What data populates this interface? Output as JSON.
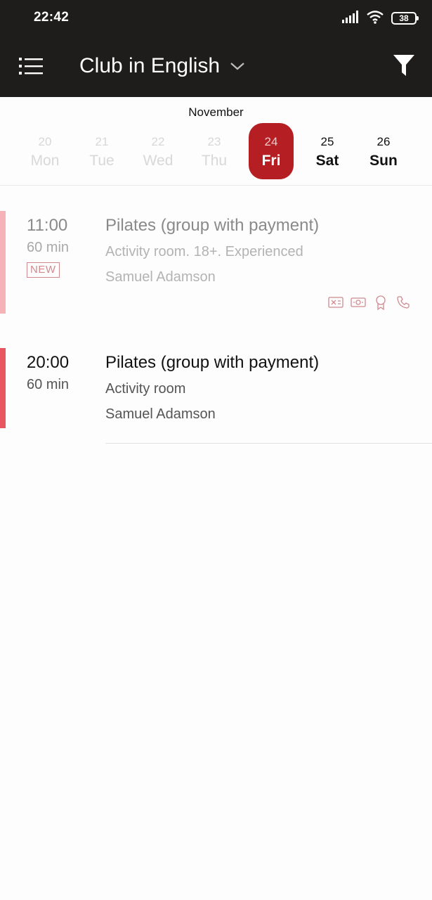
{
  "status_bar": {
    "time": "22:42",
    "battery": "38"
  },
  "app_bar": {
    "title": "Club in English",
    "menu_icon": "list-icon",
    "dropdown_icon": "chevron-down-icon",
    "filter_icon": "filter-icon"
  },
  "calendar": {
    "month": "November",
    "days": [
      {
        "num": "20",
        "weekday": "Mon",
        "state": "past"
      },
      {
        "num": "21",
        "weekday": "Tue",
        "state": "past"
      },
      {
        "num": "22",
        "weekday": "Wed",
        "state": "past"
      },
      {
        "num": "23",
        "weekday": "Thu",
        "state": "past"
      },
      {
        "num": "24",
        "weekday": "Fri",
        "state": "selected"
      },
      {
        "num": "25",
        "weekday": "Sat",
        "state": "future"
      },
      {
        "num": "26",
        "weekday": "Sun",
        "state": "future"
      }
    ]
  },
  "events": [
    {
      "time": "11:00",
      "duration": "60 min",
      "badge": "NEW",
      "title": "Pilates (group with payment)",
      "place": "Activity room. 18+. Experienced",
      "trainer": "Samuel Adamson",
      "state": "past",
      "icons": [
        "cancel-card-icon",
        "cash-icon",
        "award-icon",
        "phone-icon"
      ]
    },
    {
      "time": "20:00",
      "duration": "60 min",
      "title": "Pilates (group with payment)",
      "place": "Activity room",
      "trainer": "Samuel Adamson",
      "state": "upcoming"
    }
  ],
  "colors": {
    "app_bar": "#1f1c1c",
    "accent": "#b51f24",
    "past_event_bar": "#f6b3b7",
    "upcoming_event_bar": "#e8575f"
  }
}
